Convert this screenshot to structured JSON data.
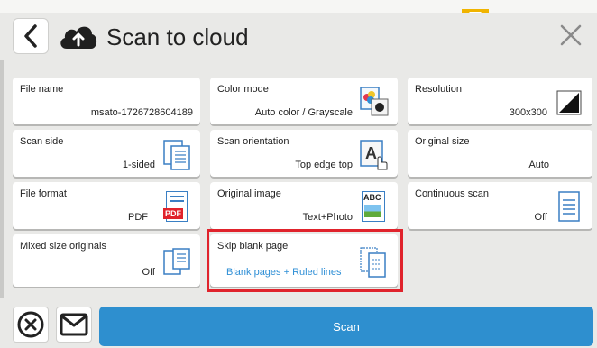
{
  "header": {
    "title": "Scan to cloud"
  },
  "tiles": {
    "file_name": {
      "label": "File name",
      "value": "msato-1726728604189"
    },
    "color_mode": {
      "label": "Color mode",
      "value": "Auto color / Grayscale"
    },
    "resolution": {
      "label": "Resolution",
      "value": "300x300"
    },
    "scan_side": {
      "label": "Scan side",
      "value": "1-sided"
    },
    "scan_orientation": {
      "label": "Scan orientation",
      "value": "Top edge top"
    },
    "original_size": {
      "label": "Original size",
      "value": "Auto"
    },
    "file_format": {
      "label": "File format",
      "value": "PDF",
      "badge": "PDF"
    },
    "original_image": {
      "label": "Original image",
      "value": "Text+Photo",
      "badge": "ABC"
    },
    "continuous_scan": {
      "label": "Continuous scan",
      "value": "Off"
    },
    "mixed_size": {
      "label": "Mixed size originals",
      "value": "Off"
    },
    "skip_blank": {
      "label": "Skip blank page",
      "value": "Blank pages + Ruled lines"
    }
  },
  "bottom": {
    "scan_label": "Scan"
  },
  "colors": {
    "accent": "#2e8fcf",
    "highlight": "#e0232c",
    "value_blue": "#2f8fd6",
    "notch": "#f0b400"
  },
  "icons": [
    "back-arrow-icon",
    "cloud-upload-icon",
    "close-icon",
    "notch-down-icon",
    "cancel-circle-icon",
    "mail-icon",
    "pages-icon",
    "color-mode-icon",
    "resolution-icon",
    "orientation-icon",
    "pdf-icon",
    "abc-icon"
  ]
}
